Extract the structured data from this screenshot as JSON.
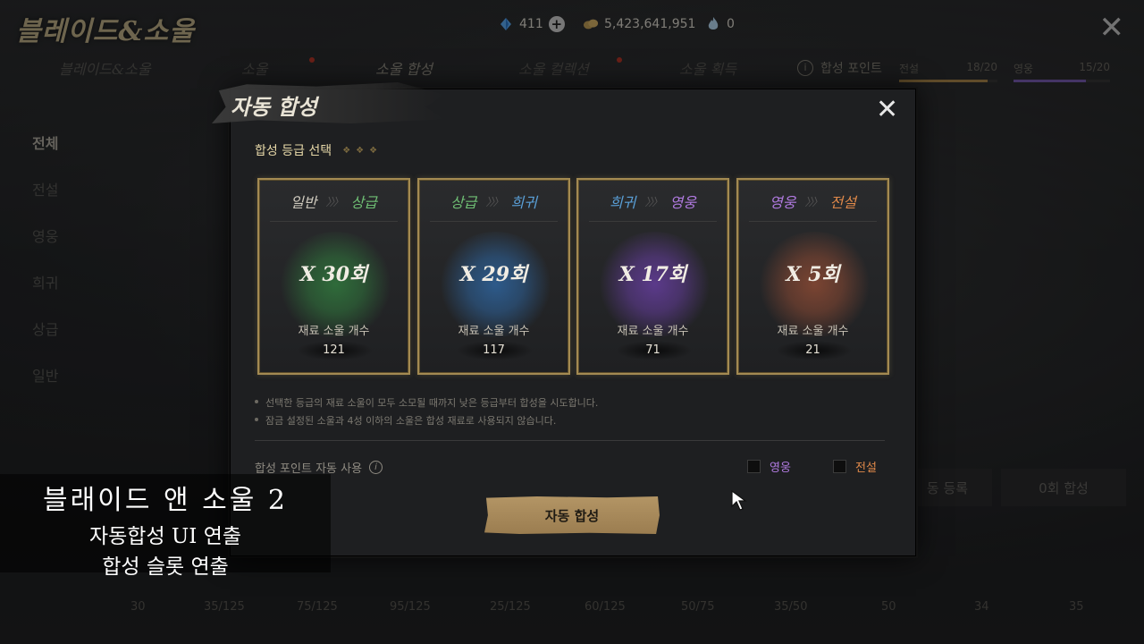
{
  "header": {
    "logo": "블레이드&소울",
    "currencies": [
      {
        "icon": "diamond-icon",
        "value": "411"
      },
      {
        "icon": "coin-icon",
        "value": "5,423,641,951"
      },
      {
        "icon": "flame-icon",
        "value": "0"
      }
    ]
  },
  "top_tabs": [
    {
      "label": "블레이드&소울"
    },
    {
      "label": "소울"
    },
    {
      "label": "소울 합성"
    },
    {
      "label": "소울 컬렉션"
    },
    {
      "label": "소울 획득"
    }
  ],
  "synthesis_points": {
    "label": "합성 포인트",
    "legend": {
      "label": "전설",
      "value": "18/20",
      "fraction": 0.9,
      "color": "#b08a4e"
    },
    "hero": {
      "label": "영웅",
      "value": "15/20",
      "fraction": 0.75,
      "color": "#7c5fb8"
    }
  },
  "side_menu": [
    "전체",
    "전설",
    "영웅",
    "희귀",
    "상급",
    "일반"
  ],
  "bottom_values": [
    "30",
    "35/125",
    "75/125",
    "95/125",
    "25/125",
    "60/125",
    "50/75",
    "35/50",
    "50",
    "34",
    "35"
  ],
  "right_buttons": [
    "동 등록",
    "0회 합성"
  ],
  "modal": {
    "title": "자동 합성",
    "grade_select_label": "합성 등급 선택",
    "cards": [
      {
        "from": "일반",
        "to": "상급",
        "from_color": "#cfcabe",
        "to_color": "#6fbf74",
        "glow": "#2f6b3a",
        "count": "X 30회",
        "material_label": "재료 소울 개수",
        "material": "121"
      },
      {
        "from": "상급",
        "to": "희귀",
        "from_color": "#6fbf74",
        "to_color": "#5aa0d8",
        "glow": "#2d5a8a",
        "count": "X 29회",
        "material_label": "재료 소울 개수",
        "material": "117"
      },
      {
        "from": "희귀",
        "to": "영웅",
        "from_color": "#5aa0d8",
        "to_color": "#b07ae0",
        "glow": "#5b3a8a",
        "count": "X 17회",
        "material_label": "재료 소울 개수",
        "material": "71"
      },
      {
        "from": "영웅",
        "to": "전설",
        "from_color": "#b07ae0",
        "to_color": "#e0894a",
        "glow": "#7a4432",
        "count": "X 5회",
        "material_label": "재료 소울 개수",
        "material": "21"
      }
    ],
    "notes": [
      "선택한 등급의 재료 소울이 모두 소모될 때까지 낮은 등급부터 합성을 시도합니다.",
      "잠금 설정된 소울과 4성 이하의 소울은 합성 재료로 사용되지 않습니다."
    ],
    "auto_use_label": "합성 포인트 자동 사용",
    "checkbox_hero": "영웅",
    "checkbox_legend": "전설",
    "checkbox_hero_color": "#b07ae0",
    "checkbox_legend_color": "#e0894a",
    "button": "자동 합성"
  },
  "caption": {
    "line1": "블래이드 앤 소울 2",
    "line2": "자동합성 UI 연출",
    "line3": "합성 슬롯 연출"
  }
}
